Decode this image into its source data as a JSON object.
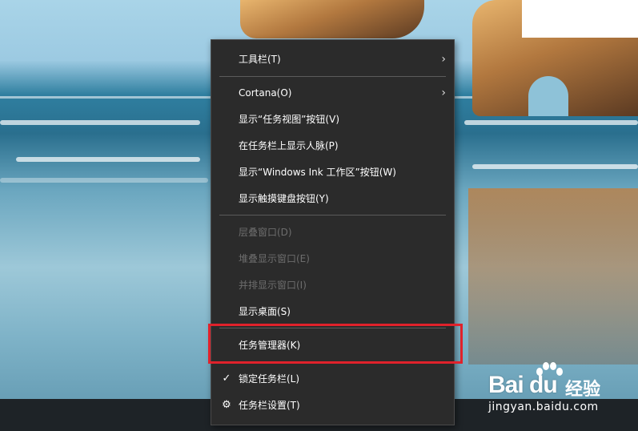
{
  "menu": {
    "items": [
      {
        "label": "工具栏(T)",
        "submenu": true,
        "disabled": false
      },
      {
        "label": "Cortana(O)",
        "submenu": true,
        "disabled": false
      },
      {
        "label": "显示“任务视图”按钮(V)",
        "disabled": false
      },
      {
        "label": "在任务栏上显示人脉(P)",
        "disabled": false
      },
      {
        "label": "显示“Windows Ink 工作区”按钮(W)",
        "disabled": false
      },
      {
        "label": "显示触摸键盘按钮(Y)",
        "disabled": false
      },
      {
        "label": "层叠窗口(D)",
        "disabled": true
      },
      {
        "label": "堆叠显示窗口(E)",
        "disabled": true
      },
      {
        "label": "并排显示窗口(I)",
        "disabled": true
      },
      {
        "label": "显示桌面(S)",
        "disabled": false
      },
      {
        "label": "任务管理器(K)",
        "disabled": false,
        "highlighted": true
      },
      {
        "label": "锁定任务栏(L)",
        "checked": true,
        "icon": "checkmark-icon",
        "disabled": false
      },
      {
        "label": "任务栏设置(T)",
        "icon": "gear-icon",
        "disabled": false
      }
    ],
    "glyphs": {
      "chevron": "›",
      "check": "✓",
      "gear": "⚙"
    }
  },
  "colors": {
    "menu_bg": "#2b2b2b",
    "menu_text": "#ffffff",
    "disabled_text": "#6d6d6d",
    "highlight_border": "#e0222b"
  },
  "watermark": {
    "logo": "Bai du",
    "logo_cn": "经验",
    "url": "jingyan.baidu.com"
  }
}
